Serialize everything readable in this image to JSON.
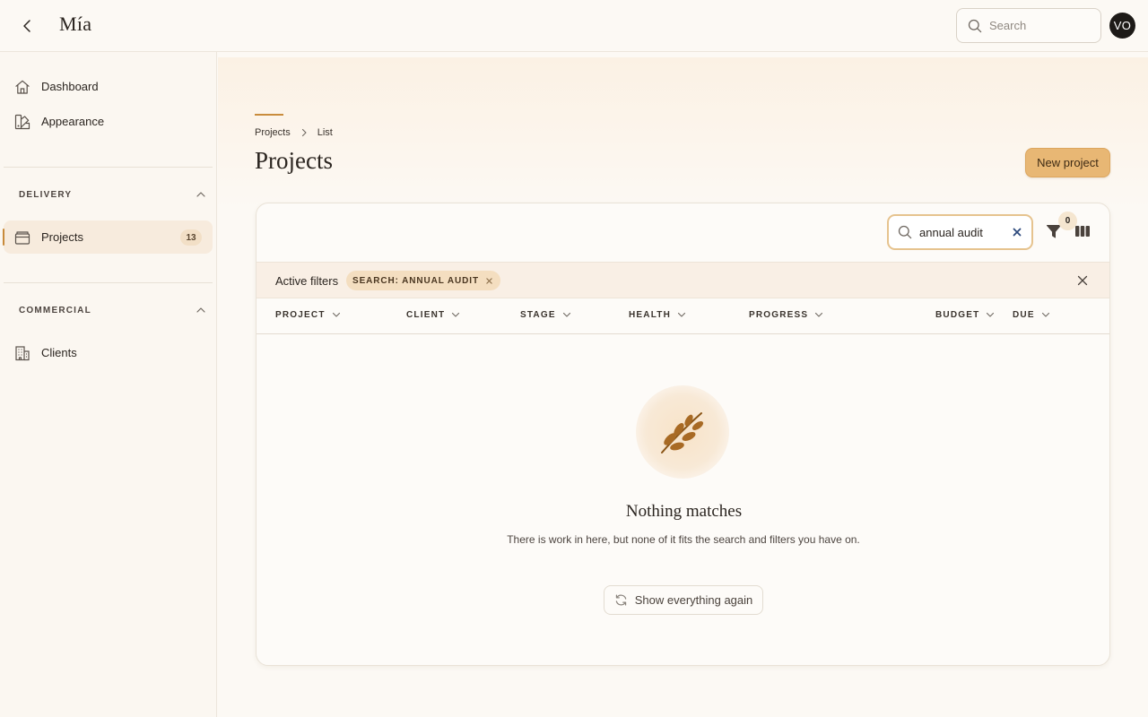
{
  "app": {
    "brand": "Mía"
  },
  "header": {
    "search_placeholder": "Search",
    "avatar_initials": "VO"
  },
  "sidebar": {
    "top_items": [
      {
        "label": "Dashboard",
        "icon": "home-icon"
      },
      {
        "label": "Appearance",
        "icon": "palette-icon"
      }
    ],
    "sections": [
      {
        "title": "DELIVERY",
        "expanded": true,
        "items": [
          {
            "label": "Projects",
            "icon": "box-icon",
            "count": "13",
            "active": true
          }
        ]
      },
      {
        "title": "COMMERCIAL",
        "expanded": true,
        "items": [
          {
            "label": "Clients",
            "icon": "building-icon"
          }
        ]
      }
    ]
  },
  "page": {
    "breadcrumb": [
      "Projects",
      "List"
    ],
    "title": "Projects",
    "new_button": "New project"
  },
  "table": {
    "search_value": "annual audit",
    "filter_count": "0",
    "active_filters_label": "Active filters",
    "chips": [
      {
        "label": "SEARCH: ANNUAL AUDIT"
      }
    ],
    "columns": [
      "PROJECT",
      "CLIENT",
      "STAGE",
      "HEALTH",
      "PROGRESS",
      "BUDGET",
      "DUE"
    ],
    "empty": {
      "title": "Nothing matches",
      "description": "There is work in here, but none of it fits the search and filters you have on.",
      "reset_label": "Show everything again"
    }
  },
  "colors": {
    "accent": "#e8b774",
    "accent_dark": "#c88a3a",
    "background": "#fcf9f4",
    "text": "#2b2520"
  }
}
